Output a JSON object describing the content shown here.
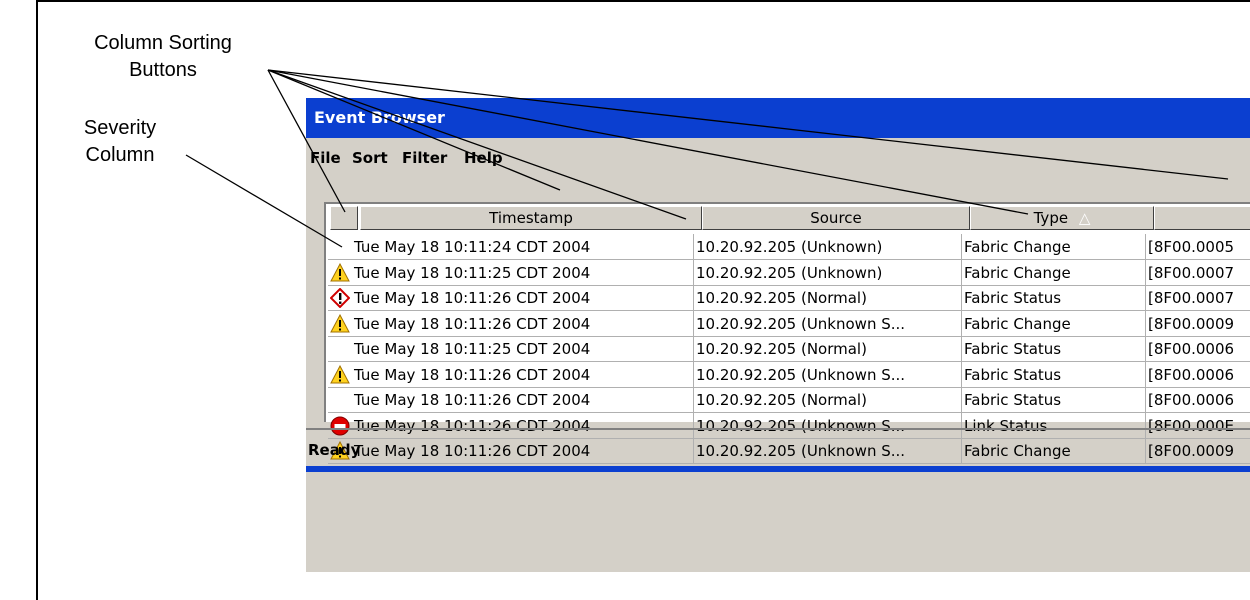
{
  "annotations": {
    "sort_buttons_line1": "Column Sorting",
    "sort_buttons_line2": "Buttons",
    "severity_line1": "Severity",
    "severity_line2": "Column"
  },
  "window": {
    "title": "Event Browser",
    "menu": [
      "File",
      "Sort",
      "Filter",
      "Help"
    ],
    "status": "Ready",
    "title_color": "#0b3fd0"
  },
  "table": {
    "columns": [
      "",
      "Timestamp",
      "Source",
      "Type",
      ""
    ],
    "sort_indicator": "△",
    "rows": [
      {
        "severity": "none",
        "timestamp": "Tue May 18 10:11:24 CDT 2004",
        "source": "10.20.92.205 (Unknown)",
        "type": "Fabric Change",
        "id": "[8F00.0005"
      },
      {
        "severity": "warning-icon",
        "timestamp": "Tue May 18 10:11:25 CDT 2004",
        "source": "10.20.92.205 (Unknown)",
        "type": "Fabric Change",
        "id": "[8F00.0007"
      },
      {
        "severity": "error-icon",
        "timestamp": "Tue May 18 10:11:26 CDT 2004",
        "source": "10.20.92.205 (Normal)",
        "type": "Fabric Status",
        "id": "[8F00.0007"
      },
      {
        "severity": "warning-icon",
        "timestamp": "Tue May 18 10:11:26 CDT 2004",
        "source": "10.20.92.205 (Unknown S...",
        "type": "Fabric Change",
        "id": "[8F00.0009"
      },
      {
        "severity": "none",
        "timestamp": "Tue May 18 10:11:25 CDT 2004",
        "source": "10.20.92.205 (Normal)",
        "type": "Fabric Status",
        "id": "[8F00.0006"
      },
      {
        "severity": "warning-icon",
        "timestamp": "Tue May 18 10:11:26 CDT 2004",
        "source": "10.20.92.205 (Unknown S...",
        "type": "Fabric Status",
        "id": "[8F00.0006"
      },
      {
        "severity": "none",
        "timestamp": "Tue May 18 10:11:26 CDT 2004",
        "source": "10.20.92.205 (Normal)",
        "type": "Fabric Status",
        "id": "[8F00.0006"
      },
      {
        "severity": "critical-icon",
        "timestamp": "Tue May 18 10:11:26 CDT 2004",
        "source": "10.20.92.205 (Unknown S...",
        "type": "Link Status",
        "id": "[8F00.000E"
      },
      {
        "severity": "warning-icon",
        "timestamp": "Tue May 18 10:11:26 CDT 2004",
        "source": "10.20.92.205 (Unknown S...",
        "type": "Fabric Change",
        "id": "[8F00.0009"
      }
    ]
  }
}
